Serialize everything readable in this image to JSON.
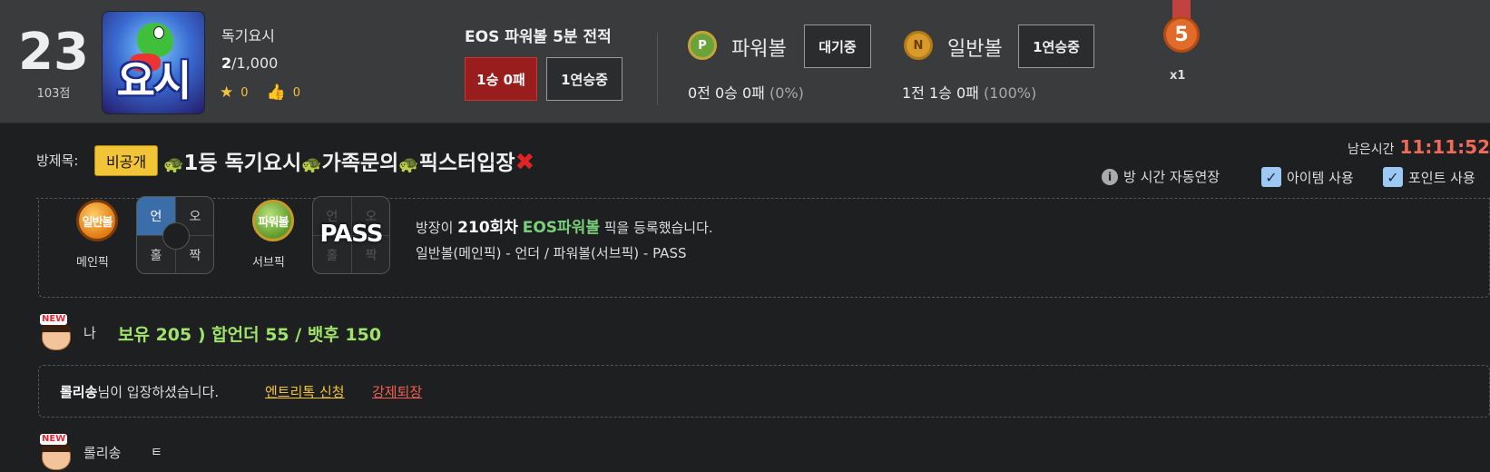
{
  "profile": {
    "rank": "23",
    "points": "103점",
    "avatar_text": "요시",
    "name": "독기요시",
    "count_current": "2",
    "count_total": "/1,000",
    "stars": "0",
    "likes": "0"
  },
  "eos": {
    "title": "EOS 파워볼 5분 전적",
    "record_btn": "1승 0패",
    "streak_btn": "1연승중"
  },
  "powerball": {
    "coin": "P",
    "label": "파워볼",
    "status_btn": "대기중",
    "record": "0전 0승 0패",
    "percent": "(0%)"
  },
  "normalball": {
    "coin": "N",
    "label": "일반볼",
    "status_btn": "1연승중",
    "record": "1전 1승 0패",
    "percent": "(100%)"
  },
  "medal": {
    "number": "5",
    "count": "x1"
  },
  "room": {
    "title_label": "방제목:",
    "private_badge": "비공개",
    "title_text": "1등 독기요시",
    "title_part2": "가족문의",
    "title_part3": "픽스터입장",
    "remaining_label": "남은시간",
    "remaining_time": "11:11:52",
    "opt_auto_extend": "방 시간 자동연장",
    "opt_item": "아이템 사용",
    "opt_point": "포인트 사용"
  },
  "pick": {
    "main_ball": "일반볼",
    "main_caption": "메인픽",
    "main_cells": [
      "언",
      "오",
      "홀",
      "짝"
    ],
    "sub_ball": "파워볼",
    "sub_caption": "서브픽",
    "sub_cells": [
      "언",
      "오",
      "홀",
      "짝"
    ],
    "sub_pass": "PASS",
    "line1_pre": "방장이 ",
    "line1_round": "210회차",
    "line1_game": "EOS파워볼",
    "line1_post": " 픽을 등록했습니다.",
    "line2": "일반볼(메인픽) - 언더 / 파워볼(서브픽) - PASS"
  },
  "chat": {
    "new_tag": "NEW",
    "msg1_user": "나",
    "msg1_text": "보유 205 ) 합언더 55 / 뱃후 150",
    "notice_user": "롤리송",
    "notice_text": "님이 입장하셨습니다.",
    "notice_link1": "엔트리톡 신청",
    "notice_link2": "강제퇴장",
    "msg2_user": "롤리송",
    "msg2_text": "ㅌ"
  },
  "colors": {
    "accent_red": "#9a1d1d",
    "time_red": "#f06a5a",
    "badge_yellow": "#f2c437",
    "chat_green": "#9fe36a"
  }
}
